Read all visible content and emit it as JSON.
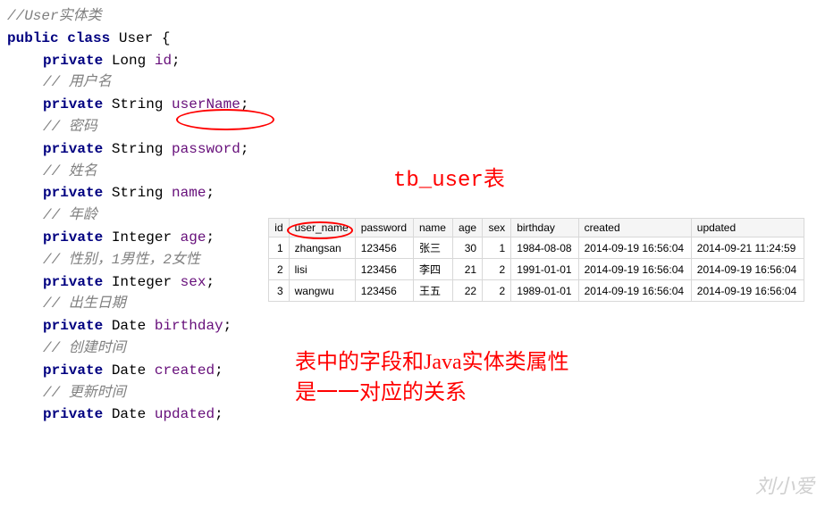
{
  "code": {
    "c1": "//User实体类",
    "kw_public": "public",
    "kw_class": "class",
    "cls": "User",
    "brace_open": " {",
    "kw_private": "private",
    "t_long": "Long",
    "t_string": "String",
    "t_integer": "Integer",
    "t_date": "Date",
    "f_id": "id",
    "f_userName": "userName",
    "f_password": "password",
    "f_name": "name",
    "f_age": "age",
    "f_sex": "sex",
    "f_birthday": "birthday",
    "f_created": "created",
    "f_updated": "updated",
    "semi": ";",
    "c_username": "// 用户名",
    "c_password": "// 密码",
    "c_name": "// 姓名",
    "c_age": "// 年龄",
    "c_sex": "// 性别，1男性，2女性",
    "c_birthday": "// 出生日期",
    "c_created": "// 创建时间",
    "c_updated": "// 更新时间"
  },
  "title": "tb_user表",
  "table": {
    "headers": [
      "id",
      "user_name",
      "password",
      "name",
      "age",
      "sex",
      "birthday",
      "created",
      "updated"
    ],
    "rows": [
      {
        "id": "1",
        "user_name": "zhangsan",
        "password": "123456",
        "name": "张三",
        "age": "30",
        "sex": "1",
        "birthday": "1984-08-08",
        "created": "2014-09-19 16:56:04",
        "updated": "2014-09-21 11:24:59"
      },
      {
        "id": "2",
        "user_name": "lisi",
        "password": "123456",
        "name": "李四",
        "age": "21",
        "sex": "2",
        "birthday": "1991-01-01",
        "created": "2014-09-19 16:56:04",
        "updated": "2014-09-19 16:56:04"
      },
      {
        "id": "3",
        "user_name": "wangwu",
        "password": "123456",
        "name": "王五",
        "age": "22",
        "sex": "2",
        "birthday": "1989-01-01",
        "created": "2014-09-19 16:56:04",
        "updated": "2014-09-19 16:56:04"
      }
    ]
  },
  "desc_line1": "表中的字段和Java实体类属性",
  "desc_line2": "是一一对应的关系",
  "watermark": "刘小爱"
}
